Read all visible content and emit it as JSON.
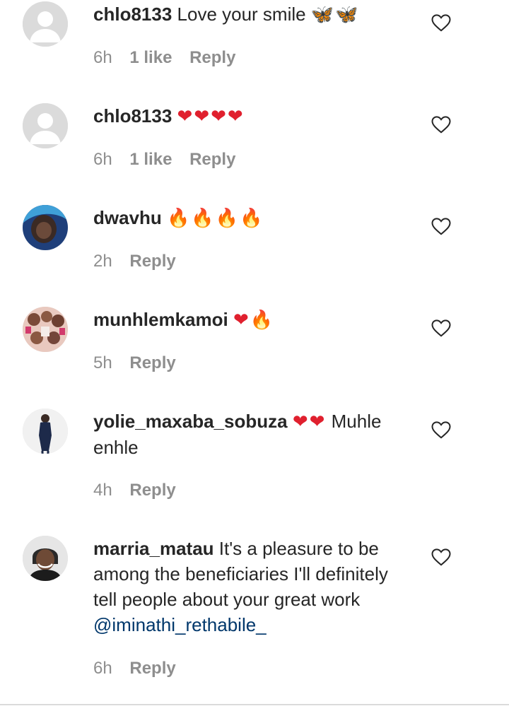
{
  "comments": [
    {
      "user": "chlo8133",
      "text": " Love your smile ",
      "emoji": "🦋🦋",
      "emoji_class": "fly",
      "time": "6h",
      "likes": "1 like",
      "reply": "Reply",
      "avatar": "default-avatar"
    },
    {
      "user": "chlo8133",
      "text": " ",
      "emoji": "❤❤❤❤",
      "emoji_class": "heart",
      "time": "6h",
      "likes": "1 like",
      "reply": "Reply",
      "avatar": "default-avatar"
    },
    {
      "user": "dwavhu",
      "text": " ",
      "emoji": "🔥🔥🔥🔥",
      "emoji_class": "fire",
      "time": "2h",
      "likes": "",
      "reply": "Reply",
      "avatar": "photo-avatar"
    },
    {
      "user": "munhlemkamoi",
      "text": " ",
      "emoji": "❤🔥",
      "emoji_class": "mixed",
      "time": "5h",
      "likes": "",
      "reply": "Reply",
      "avatar": "collage-avatar"
    },
    {
      "user": "yolie_maxaba_sobuza",
      "text_after": " Muhle enhle",
      "emoji": "❤❤",
      "emoji_class": "heart",
      "time": "4h",
      "likes": "",
      "reply": "Reply",
      "avatar": "photo-avatar"
    },
    {
      "user": "marria_matau",
      "text": " It's a pleasure to be among the beneficiaries I'll definitely tell people about your great work ",
      "mention": "@iminathi_rethabile_",
      "time": "6h",
      "likes": "",
      "reply": "Reply",
      "avatar": "photo-avatar"
    }
  ],
  "colors": {
    "text": "#262626",
    "meta": "#8e8e8e",
    "mention": "#00376b",
    "heart": "#e0202e",
    "fire": "#f57c00"
  }
}
